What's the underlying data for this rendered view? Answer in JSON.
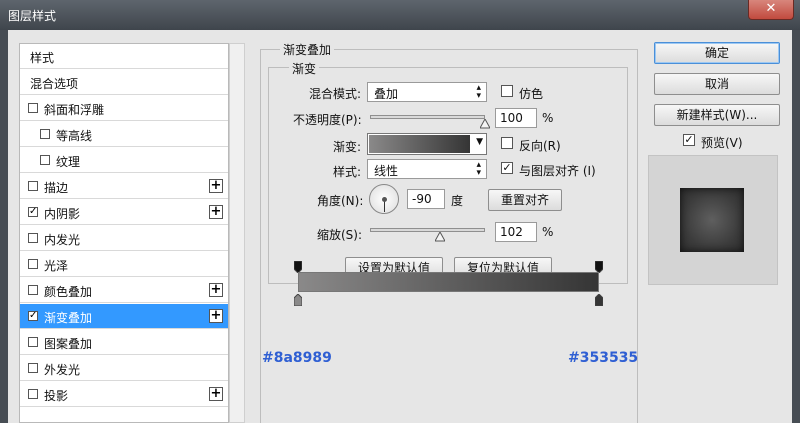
{
  "window": {
    "title": "图层样式",
    "close_glyph": "✕"
  },
  "styles_list": {
    "items": [
      {
        "label": "样式",
        "has_checkbox": false,
        "checked": false,
        "has_plus": false,
        "selected": false
      },
      {
        "label": "混合选项",
        "has_checkbox": false,
        "checked": false,
        "has_plus": false,
        "selected": false
      },
      {
        "label": "斜面和浮雕",
        "has_checkbox": true,
        "checked": false,
        "has_plus": false,
        "selected": false
      },
      {
        "label": "等高线",
        "has_checkbox": true,
        "checked": false,
        "has_plus": false,
        "selected": false,
        "indent": true
      },
      {
        "label": "纹理",
        "has_checkbox": true,
        "checked": false,
        "has_plus": false,
        "selected": false,
        "indent": true
      },
      {
        "label": "描边",
        "has_checkbox": true,
        "checked": false,
        "has_plus": true,
        "selected": false
      },
      {
        "label": "内阴影",
        "has_checkbox": true,
        "checked": true,
        "has_plus": true,
        "selected": false
      },
      {
        "label": "内发光",
        "has_checkbox": true,
        "checked": false,
        "has_plus": false,
        "selected": false
      },
      {
        "label": "光泽",
        "has_checkbox": true,
        "checked": false,
        "has_plus": false,
        "selected": false
      },
      {
        "label": "颜色叠加",
        "has_checkbox": true,
        "checked": false,
        "has_plus": true,
        "selected": false
      },
      {
        "label": "渐变叠加",
        "has_checkbox": true,
        "checked": true,
        "has_plus": true,
        "selected": true
      },
      {
        "label": "图案叠加",
        "has_checkbox": true,
        "checked": false,
        "has_plus": false,
        "selected": false
      },
      {
        "label": "外发光",
        "has_checkbox": true,
        "checked": false,
        "has_plus": false,
        "selected": false
      },
      {
        "label": "投影",
        "has_checkbox": true,
        "checked": false,
        "has_plus": true,
        "selected": false
      }
    ],
    "check_glyph": "✓",
    "plus_glyph": "+"
  },
  "gradient_overlay": {
    "section_title": "渐变叠加",
    "subsection_title": "渐变",
    "blend_mode_label": "混合模式:",
    "blend_mode_value": "叠加",
    "dither_label": "仿色",
    "dither_checked": false,
    "opacity_label": "不透明度(P):",
    "opacity_value": "100",
    "opacity_percent": 100,
    "percent_unit": "%",
    "gradient_label": "渐变:",
    "reverse_label": "反向(R)",
    "reverse_checked": false,
    "style_label": "样式:",
    "style_value": "线性",
    "align_label": "与图层对齐 (I)",
    "align_checked": true,
    "angle_label": "角度(N):",
    "angle_value": "-90",
    "angle_unit": "度",
    "reset_align_button": "重置对齐",
    "scale_label": "缩放(S):",
    "scale_value": "102",
    "scale_percent": 102,
    "set_default_button": "设置为默认值",
    "reset_default_button": "复位为默认值"
  },
  "gradient_editor": {
    "start_color": "#8a8989",
    "end_color": "#353535",
    "start_label": "#8a8989",
    "end_label": "#353535",
    "label_color": "#2f5fd3"
  },
  "buttons": {
    "ok": "确定",
    "cancel": "取消",
    "new_style": "新建样式(W)...",
    "preview_label": "预览(V)",
    "preview_checked": true
  },
  "select_arrow_glyph": "▲▼",
  "dropdown_arrow_glyph": "▼"
}
